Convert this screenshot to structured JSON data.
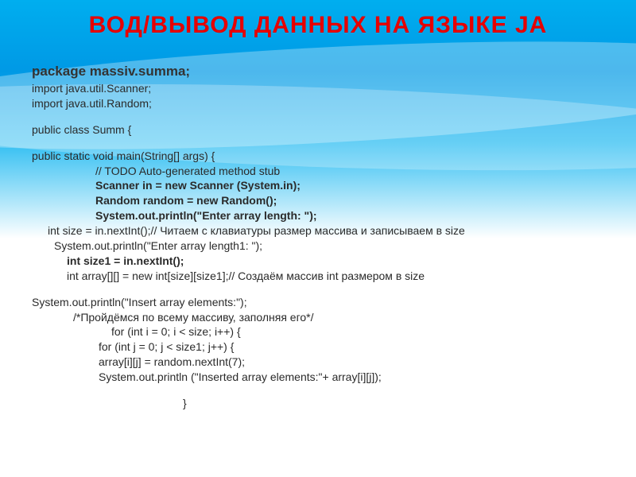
{
  "title": "ВОД/ВЫВОД ДАННЫХ НА ЯЗЫКЕ JA",
  "code": {
    "line1": "package massiv.summa;",
    "line2": "import java.util.Scanner;",
    "line3": "import java.util.Random;",
    "line4": "public class Summ {",
    "line5": "public static void main(String[] args) {",
    "line6": "// TODO Auto-generated method stub",
    "line7": "Scanner in = new Scanner (System.in);",
    "line8": "Random random = new Random();",
    "line9": "System.out.println(\"Enter array length: \");",
    "line10": " int size = in.nextInt();// Читаем с клавиатуры размер массива и записываем в size",
    "line11": "  System.out.println(\"Enter array length1: \");",
    "line12": "int size1 = in.nextInt();",
    "line13": " int array[][] = new int[size][size1];// Создаём массив int размером в size",
    "line14": " System.out.println(\"Insert array elements:\");",
    "line15": "/*Пройдёмся по всему массиву, заполняя его*/",
    "line16": "for (int i = 0; i < size; i++) {",
    "line17": "for (int j = 0; j < size1; j++) {",
    "line18": "array[i][j] = random.nextInt(7);",
    "line19": "System.out.println (\"Inserted array elements:\"+ array[i][j]);",
    "line20": "}"
  }
}
